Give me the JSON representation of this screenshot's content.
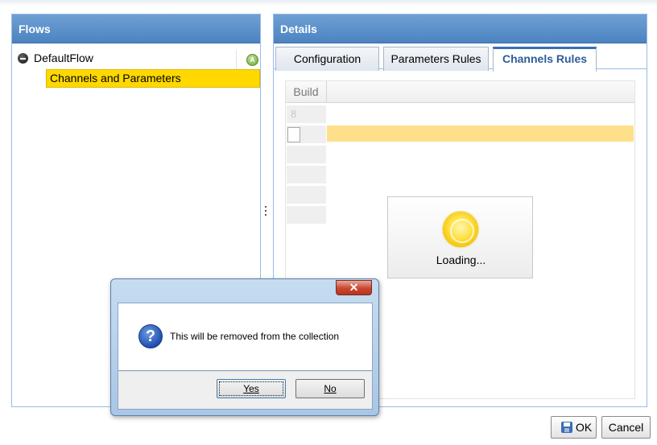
{
  "flows_panel": {
    "title": "Flows",
    "tree": {
      "root_label": "DefaultFlow",
      "status_icon": "green-status-icon",
      "child_label": "Channels and Parameters"
    }
  },
  "details_panel": {
    "title": "Details",
    "tabs": [
      {
        "label": "Configuration",
        "active": false
      },
      {
        "label": "Parameters Rules",
        "active": false
      },
      {
        "label": "Channels Rules",
        "active": true
      }
    ],
    "grid": {
      "columns": [
        "Build"
      ],
      "rows": [
        "8",
        "",
        "",
        "",
        "",
        ""
      ]
    },
    "loading_text": "Loading..."
  },
  "footer": {
    "ok_label": "OK",
    "cancel_label": "Cancel"
  },
  "dialog": {
    "close_label": "x",
    "message": "This will be removed from the collection",
    "icon": "question-icon",
    "yes_label": "Yes",
    "no_label": "No"
  },
  "colors": {
    "header_blue": "#4b83c1",
    "selection_yellow": "#ffd800",
    "row_highlight": "#ffe08a",
    "active_tab_text": "#2e5c97"
  }
}
